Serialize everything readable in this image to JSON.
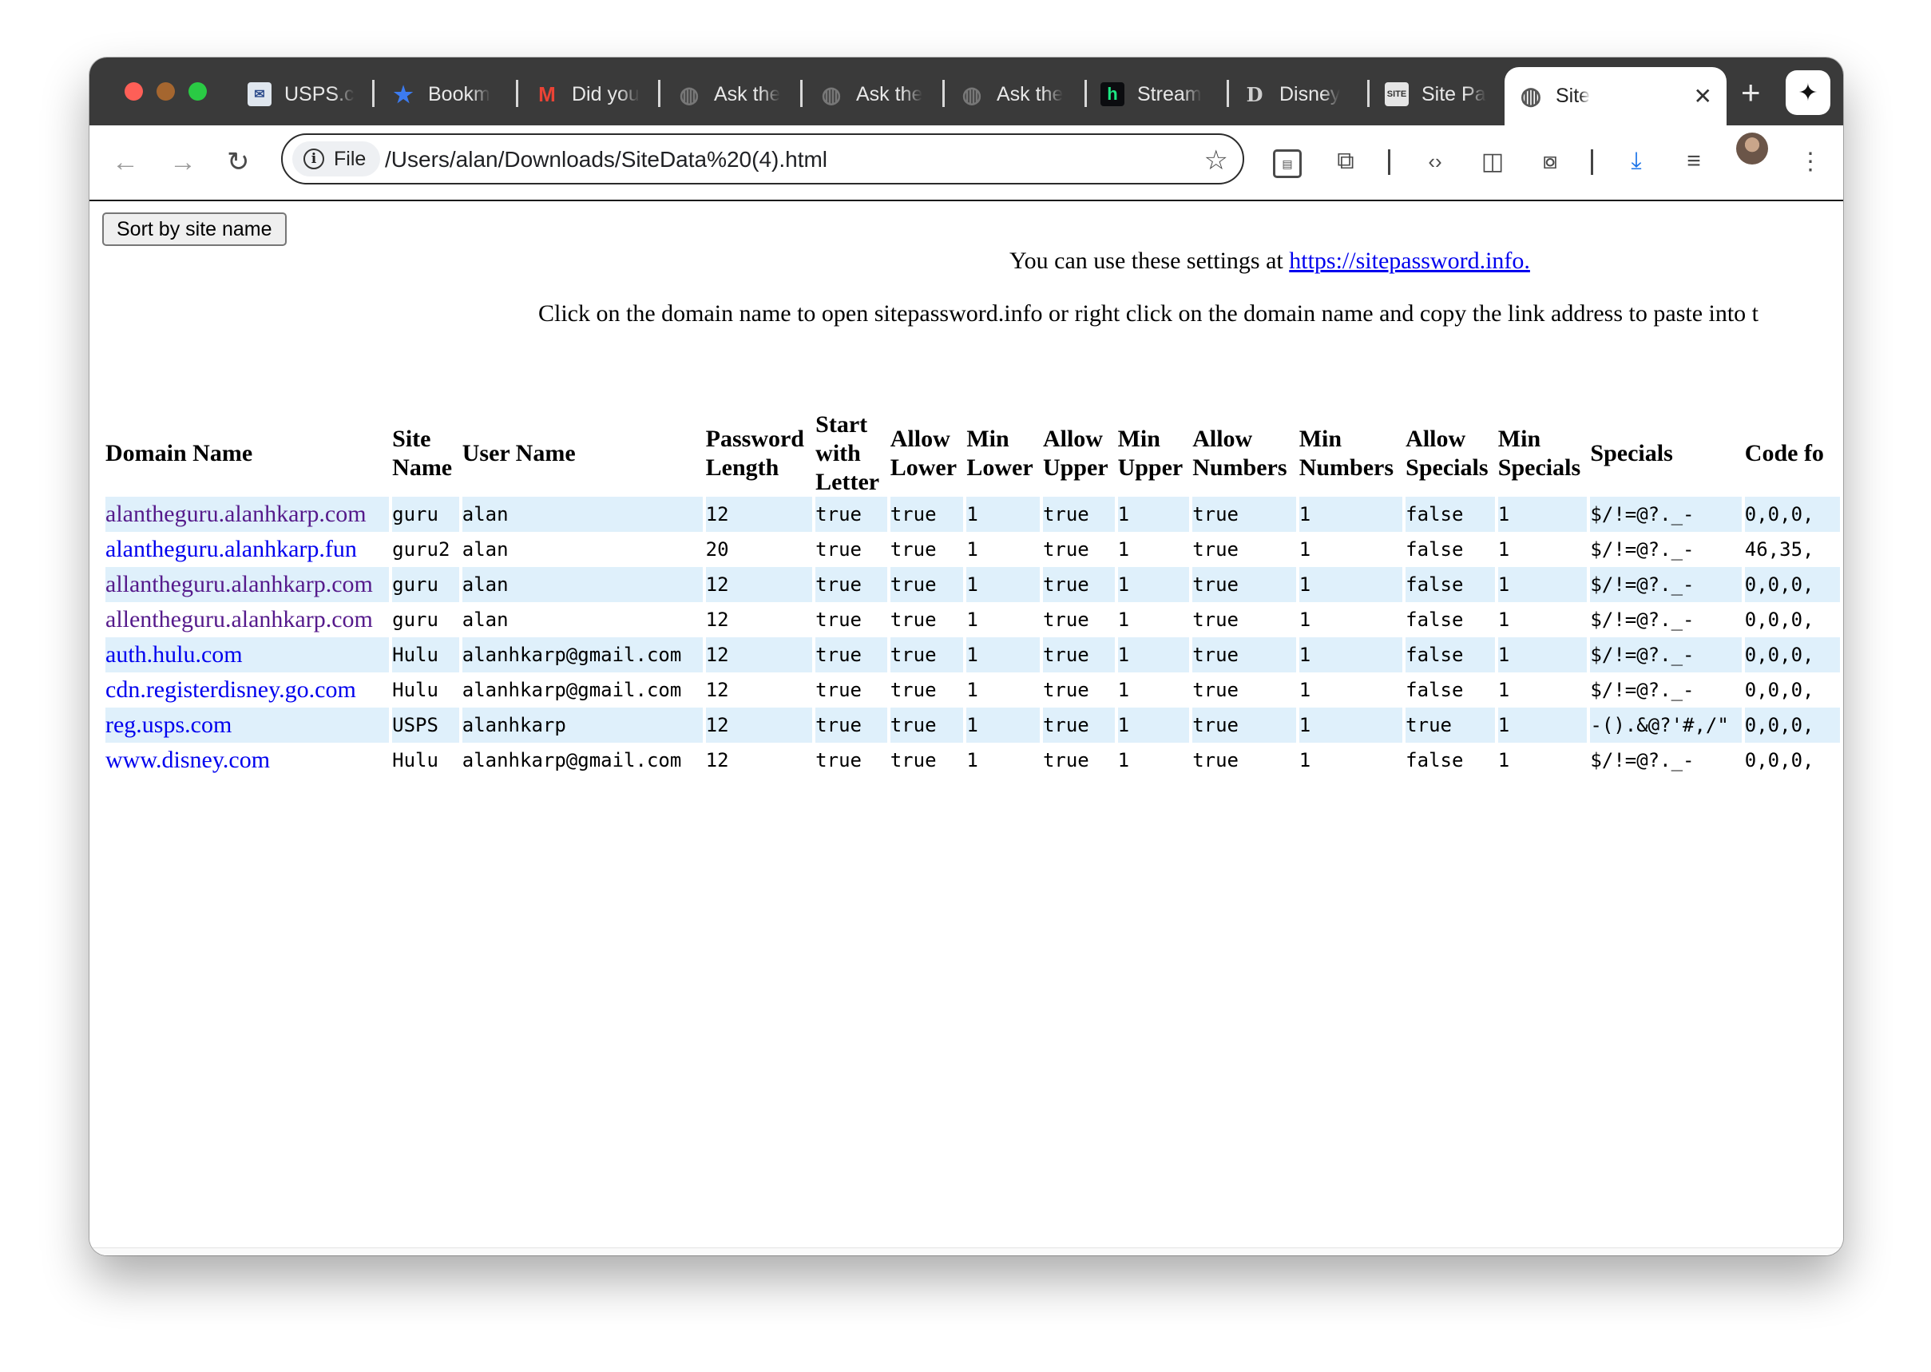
{
  "browser": {
    "tabs": [
      {
        "title": "USPS.c",
        "icon": "usps-eagle-icon"
      },
      {
        "title": "Bookm",
        "icon": "star-icon"
      },
      {
        "title": "Did you",
        "icon": "gmail-icon"
      },
      {
        "title": "Ask the",
        "icon": "globe-icon"
      },
      {
        "title": "Ask the",
        "icon": "globe-icon"
      },
      {
        "title": "Ask the",
        "icon": "globe-icon"
      },
      {
        "title": "Stream",
        "icon": "hulu-h-icon"
      },
      {
        "title": "Disney",
        "icon": "disney-icon"
      },
      {
        "title": "Site Pa",
        "icon": "site-icon"
      },
      {
        "title": "Site",
        "icon": "globe-icon",
        "active": true
      }
    ],
    "omnibox": {
      "chip_label": "File",
      "url": "/Users/alan/Downloads/SiteData%20(4).html"
    },
    "accent_color": "#1a73e8"
  },
  "page": {
    "sort_button": "Sort by site name",
    "line1_prefix": "You can use these settings at ",
    "line1_link": "https://sitepassword.info.",
    "line2": "Click on the domain name to open sitepassword.info or right click on the domain name and copy the link address to paste into t",
    "headers": [
      [
        "Domain Name"
      ],
      [
        "Site",
        "Name"
      ],
      [
        "User Name"
      ],
      [
        "Password",
        "Length"
      ],
      [
        "Start",
        "with",
        "Letter"
      ],
      [
        "Allow",
        "Lower"
      ],
      [
        "Min",
        "Lower"
      ],
      [
        "Allow",
        "Upper"
      ],
      [
        "Min",
        "Upper"
      ],
      [
        "Allow",
        "Numbers"
      ],
      [
        "Min",
        "Numbers"
      ],
      [
        "Allow",
        "Specials"
      ],
      [
        "Min",
        "Specials"
      ],
      [
        "Specials"
      ],
      [
        "Code fo"
      ]
    ],
    "rows": [
      {
        "domain": "alantheguru.alanhkarp.com",
        "visited": true,
        "cells": [
          "guru",
          "alan",
          "12",
          "true",
          "true",
          "1",
          "true",
          "1",
          "true",
          "1",
          "false",
          "1",
          "$/!=@?._-",
          "0,0,0,"
        ]
      },
      {
        "domain": "alantheguru.alanhkarp.fun",
        "visited": false,
        "cells": [
          "guru2",
          "alan",
          "20",
          "true",
          "true",
          "1",
          "true",
          "1",
          "true",
          "1",
          "false",
          "1",
          "$/!=@?._-",
          "46,35,"
        ]
      },
      {
        "domain": "allantheguru.alanhkarp.com",
        "visited": true,
        "cells": [
          "guru",
          "alan",
          "12",
          "true",
          "true",
          "1",
          "true",
          "1",
          "true",
          "1",
          "false",
          "1",
          "$/!=@?._-",
          "0,0,0,"
        ]
      },
      {
        "domain": "allentheguru.alanhkarp.com",
        "visited": true,
        "cells": [
          "guru",
          "alan",
          "12",
          "true",
          "true",
          "1",
          "true",
          "1",
          "true",
          "1",
          "false",
          "1",
          "$/!=@?._-",
          "0,0,0,"
        ]
      },
      {
        "domain": "auth.hulu.com",
        "visited": false,
        "cells": [
          "Hulu",
          "alanhkarp@gmail.com",
          "12",
          "true",
          "true",
          "1",
          "true",
          "1",
          "true",
          "1",
          "false",
          "1",
          "$/!=@?._-",
          "0,0,0,"
        ]
      },
      {
        "domain": "cdn.registerdisney.go.com",
        "visited": false,
        "cells": [
          "Hulu",
          "alanhkarp@gmail.com",
          "12",
          "true",
          "true",
          "1",
          "true",
          "1",
          "true",
          "1",
          "false",
          "1",
          "$/!=@?._-",
          "0,0,0,"
        ]
      },
      {
        "domain": "reg.usps.com",
        "visited": false,
        "cells": [
          "USPS",
          "alanhkarp",
          "12",
          "true",
          "true",
          "1",
          "true",
          "1",
          "true",
          "1",
          "true",
          "1",
          "-().&@?'#,/\"",
          "0,0,0,"
        ]
      },
      {
        "domain": "www.disney.com",
        "visited": false,
        "cells": [
          "Hulu",
          "alanhkarp@gmail.com",
          "12",
          "true",
          "true",
          "1",
          "true",
          "1",
          "true",
          "1",
          "false",
          "1",
          "$/!=@?._-",
          "0,0,0,"
        ]
      }
    ]
  }
}
